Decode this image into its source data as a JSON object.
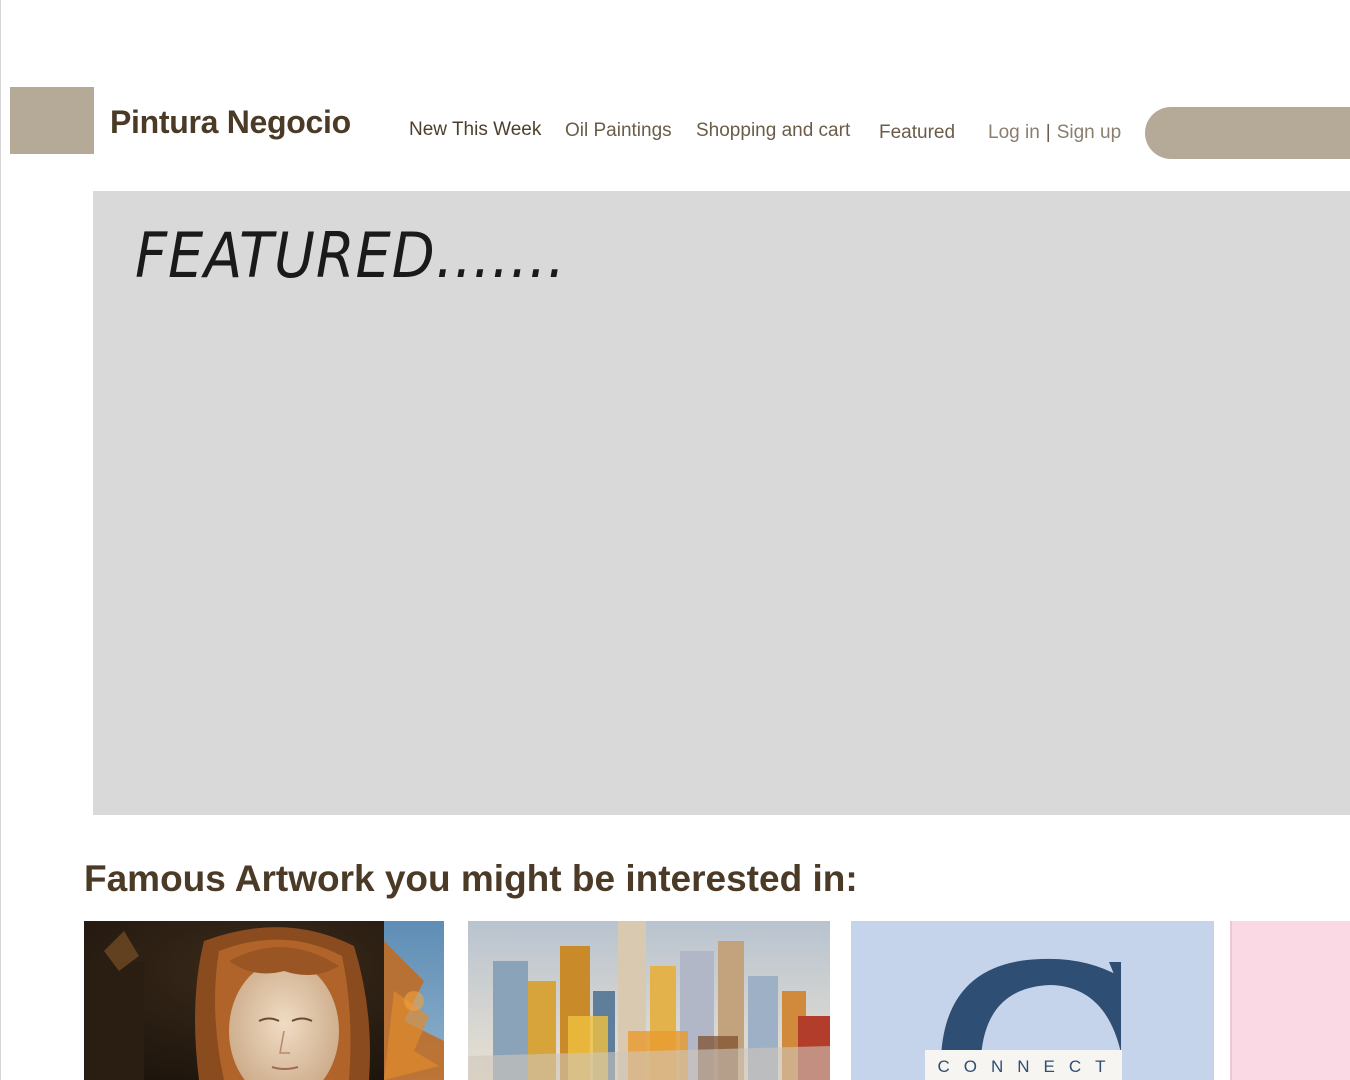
{
  "header": {
    "brand": "Pintura Negocio",
    "nav": {
      "new_this_week": "New This Week",
      "oil_paintings": "Oil Paintings",
      "shopping_and_cart": "Shopping and cart",
      "featured": "Featured"
    },
    "auth": {
      "log_in": "Log in",
      "separator": "|",
      "sign_up": "Sign up"
    }
  },
  "featured": {
    "heading": "FEATURED......."
  },
  "artwork": {
    "title": "Famous Artwork you might be interested in:",
    "cards": [
      {
        "icon": "portrait-painting-image"
      },
      {
        "icon": "city-skyline-painting-image"
      },
      {
        "icon": "connect-logo-image",
        "logo_text": "CONNECT"
      },
      {
        "icon": "pink-artwork-image"
      }
    ]
  },
  "colors": {
    "accent": "#b5aa98",
    "brand_text": "#4a3a26",
    "panel": "#d9d9d9",
    "connect_bg": "#c5d4ea",
    "connect_navy": "#2f4e73",
    "pink": "#fbd9e4"
  }
}
